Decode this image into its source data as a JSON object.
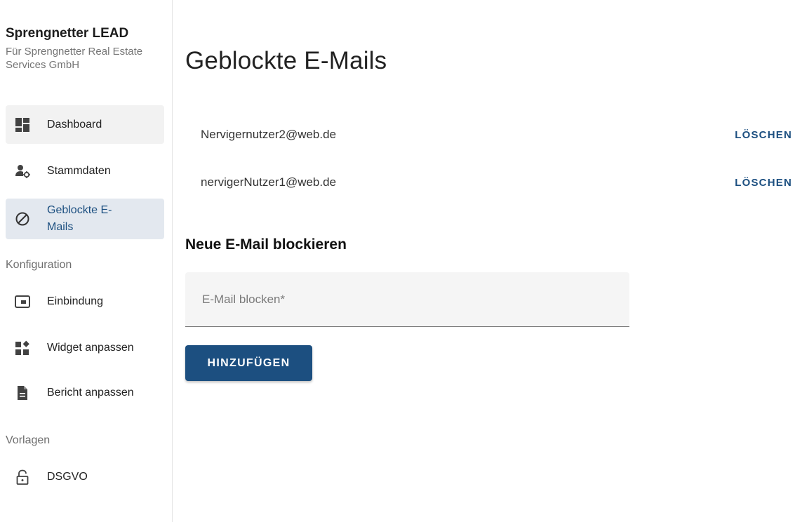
{
  "sidebar": {
    "brand_title": "Sprengnetter LEAD",
    "brand_subtitle": "Für Sprengnetter Real Estate Services GmbH",
    "items": [
      {
        "label": "Dashboard",
        "icon": "dashboard-icon"
      },
      {
        "label": "Stammdaten",
        "icon": "user-settings-icon"
      },
      {
        "label": "Geblockte E-Mails",
        "icon": "block-icon"
      },
      {
        "label": "Einbindung",
        "icon": "embed-icon"
      },
      {
        "label": "Widget anpassen",
        "icon": "widgets-icon"
      },
      {
        "label": "Bericht anpassen",
        "icon": "document-icon"
      },
      {
        "label": "DSGVO",
        "icon": "lock-icon"
      }
    ],
    "section_config": "Konfiguration",
    "section_templates": "Vorlagen"
  },
  "main": {
    "title": "Geblockte E-Mails",
    "blocked_emails": [
      {
        "email": "Nervigernutzer2@web.de",
        "action": "LÖSCHEN"
      },
      {
        "email": "nervigerNutzer1@web.de",
        "action": "LÖSCHEN"
      }
    ],
    "new_section_title": "Neue E-Mail blockieren",
    "input_placeholder": "E-Mail blocken*",
    "input_value": "",
    "add_button": "HINZUFÜGEN"
  },
  "colors": {
    "accent": "#1c4f80",
    "active_nav_bg": "#e3e8ef",
    "icon": "#424242"
  }
}
